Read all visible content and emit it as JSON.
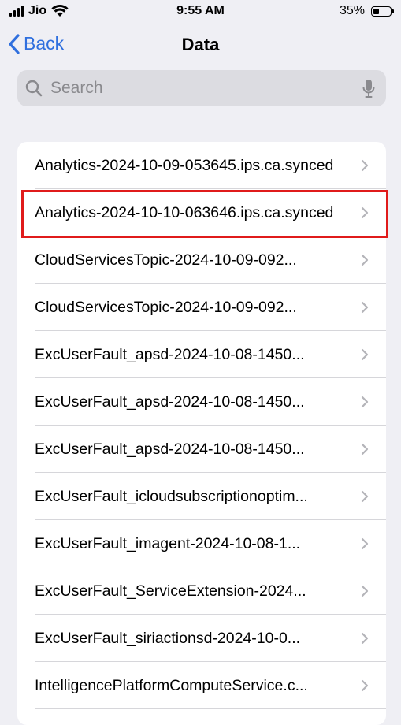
{
  "status_bar": {
    "carrier": "Jio",
    "time": "9:55 AM",
    "battery_percent": "35%",
    "battery_level": 0.35
  },
  "nav": {
    "back_label": "Back",
    "title": "Data"
  },
  "search": {
    "placeholder": "Search",
    "value": ""
  },
  "items": [
    {
      "label": "Analytics-2024-10-09-053645.ips.ca.synced"
    },
    {
      "label": "Analytics-2024-10-10-063646.ips.ca.synced"
    },
    {
      "label": "CloudServicesTopic-2024-10-09-092..."
    },
    {
      "label": "CloudServicesTopic-2024-10-09-092..."
    },
    {
      "label": "ExcUserFault_apsd-2024-10-08-1450..."
    },
    {
      "label": "ExcUserFault_apsd-2024-10-08-1450..."
    },
    {
      "label": "ExcUserFault_apsd-2024-10-08-1450..."
    },
    {
      "label": "ExcUserFault_icloudsubscriptionoptim..."
    },
    {
      "label": "ExcUserFault_imagent-2024-10-08-1..."
    },
    {
      "label": "ExcUserFault_ServiceExtension-2024..."
    },
    {
      "label": "ExcUserFault_siriactionsd-2024-10-0..."
    },
    {
      "label": "IntelligencePlatformComputeService.c..."
    }
  ],
  "highlighted_index": 1,
  "colors": {
    "accent": "#2f6fde",
    "highlight": "#e01b1b",
    "background": "#efeff4"
  }
}
